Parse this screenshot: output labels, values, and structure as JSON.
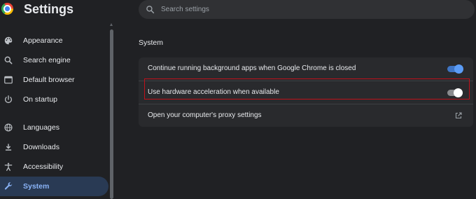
{
  "header": {
    "title": "Settings",
    "search_placeholder": "Search settings"
  },
  "sidebar": {
    "items": [
      {
        "label": "Appearance",
        "icon": "palette-icon"
      },
      {
        "label": "Search engine",
        "icon": "search-icon"
      },
      {
        "label": "Default browser",
        "icon": "browser-window-icon"
      },
      {
        "label": "On startup",
        "icon": "power-icon"
      },
      {
        "label": "Languages",
        "icon": "globe-icon"
      },
      {
        "label": "Downloads",
        "icon": "download-icon"
      },
      {
        "label": "Accessibility",
        "icon": "accessibility-icon"
      },
      {
        "label": "System",
        "icon": "wrench-icon",
        "active": true
      }
    ]
  },
  "main": {
    "section_title": "System",
    "rows": [
      {
        "label": "Continue running background apps when Google Chrome is closed",
        "control": "toggle",
        "checked": true
      },
      {
        "label": "Use hardware acceleration when available",
        "control": "toggle",
        "checked": false,
        "highlighted": true
      },
      {
        "label": "Open your computer's proxy settings",
        "control": "external-link"
      }
    ]
  },
  "colors": {
    "background": "#202124",
    "card": "#292a2d",
    "accent": "#8ab4f8",
    "active_nav": "#293a54",
    "highlight_border": "#c0111a"
  }
}
